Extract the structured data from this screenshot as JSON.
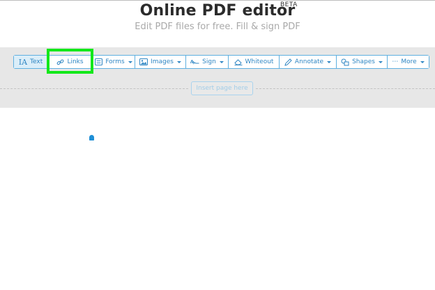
{
  "header": {
    "title": "Online PDF editor",
    "beta": "BETA",
    "subtitle": "Edit PDF files for free. Fill & sign PDF"
  },
  "toolbar": {
    "items": [
      {
        "label": "Text",
        "icon": "text-icon",
        "active": true
      },
      {
        "label": "Links",
        "icon": "link-icon"
      },
      {
        "label": "Forms",
        "icon": "form-icon",
        "dropdown": true
      },
      {
        "label": "Images",
        "icon": "image-icon",
        "dropdown": true
      },
      {
        "label": "Sign",
        "icon": "signature-icon",
        "dropdown": true
      },
      {
        "label": "Whiteout",
        "icon": "eraser-icon"
      },
      {
        "label": "Annotate",
        "icon": "pencil-icon",
        "dropdown": true
      },
      {
        "label": "Shapes",
        "icon": "shapes-icon",
        "dropdown": true
      },
      {
        "label": "More",
        "icon": "ellipsis-icon",
        "dropdown": true
      }
    ]
  },
  "page_actions": {
    "insert_page_label": "Insert page here"
  },
  "colors": {
    "accent": "#2f86c3",
    "highlight": "#13e81a",
    "toolbar_bg": "#e7e7e7"
  }
}
